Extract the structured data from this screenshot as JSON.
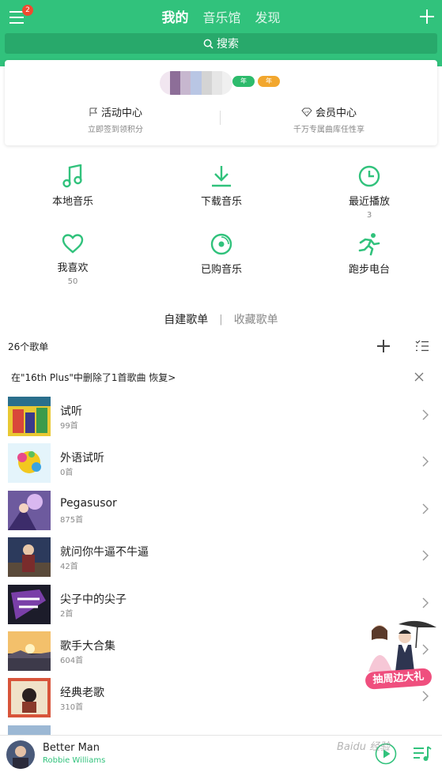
{
  "header": {
    "badge_count": "2",
    "tabs": [
      {
        "label": "我的",
        "active": true
      },
      {
        "label": "音乐馆",
        "active": false
      },
      {
        "label": "发现",
        "active": false
      }
    ],
    "search_label": "搜索",
    "accent_color": "#31c27c"
  },
  "profile": {
    "vip_badges": [
      "年",
      "年"
    ],
    "activity": {
      "title": "活动中心",
      "subtitle": "立即签到领积分"
    },
    "member": {
      "title": "会员中心",
      "subtitle": "千万专属曲库任性享"
    }
  },
  "grid": [
    {
      "label": "本地音乐",
      "count": "",
      "icon": "music-note-icon"
    },
    {
      "label": "下载音乐",
      "count": "",
      "icon": "download-icon"
    },
    {
      "label": "最近播放",
      "count": "3",
      "icon": "clock-icon"
    },
    {
      "label": "我喜欢",
      "count": "50",
      "icon": "heart-icon"
    },
    {
      "label": "已购音乐",
      "count": "",
      "icon": "disc-icon"
    },
    {
      "label": "跑步电台",
      "count": "",
      "icon": "running-icon"
    }
  ],
  "playlist_tabs": {
    "created": "自建歌单",
    "separator": "|",
    "collected": "收藏歌单"
  },
  "playlist_count": "26个歌单",
  "notice": "在\"16th Plus\"中删除了1首歌曲 恢复>",
  "playlists": [
    {
      "name": "试听",
      "count": "99首"
    },
    {
      "name": "外语试听",
      "count": "0首"
    },
    {
      "name": "Pegasusor",
      "count": "875首"
    },
    {
      "name": "就问你牛逼不牛逼",
      "count": "42首"
    },
    {
      "name": "尖子中的尖子",
      "count": "2首"
    },
    {
      "name": "歌手大合集",
      "count": "604首"
    },
    {
      "name": "经典老歌",
      "count": "310首"
    }
  ],
  "promo_text": "抽周边大礼",
  "player": {
    "title": "Better Man",
    "artist": "Robbie Williams"
  },
  "watermark": "Baidu 经验"
}
